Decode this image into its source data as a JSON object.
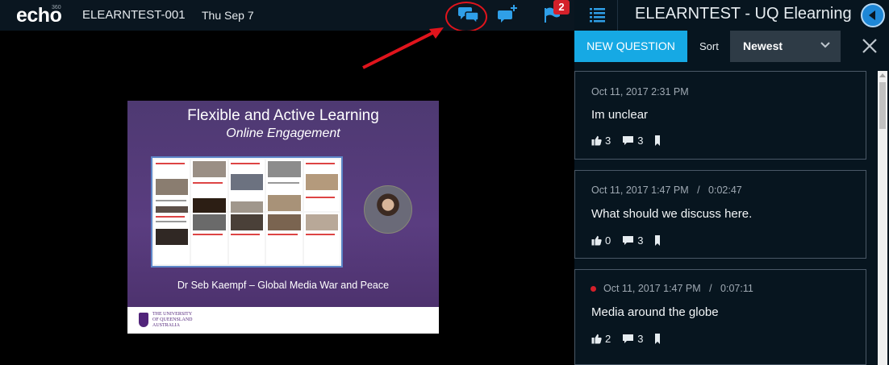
{
  "header": {
    "logo": "echo",
    "logo_sup": "360",
    "course": "ELEARNTEST-001",
    "date": "Thu Sep 7",
    "flag_badge": "2",
    "icons": [
      "discussions-icon",
      "add-discussion-icon",
      "flag-icon"
    ]
  },
  "slide": {
    "title": "Flexible and Active Learning",
    "subtitle": "Online Engagement",
    "footer": "Dr Seb Kaempf – Global Media War and Peace",
    "uq_line1": "THE UNIVERSITY",
    "uq_line2": "OF QUEENSLAND",
    "uq_line3": "AUSTRALIA"
  },
  "panel": {
    "title": "ELEARNTEST - UQ Elearning",
    "new_question": "NEW QUESTION",
    "sort_label": "Sort",
    "sort_value": "Newest"
  },
  "questions": [
    {
      "date": "Oct 11, 2017 2:31 PM",
      "sep": "",
      "timecode": "",
      "text": "Im unclear",
      "likes": "3",
      "comments": "3",
      "unread": false
    },
    {
      "date": "Oct 11, 2017 1:47 PM",
      "sep": "/",
      "timecode": "0:02:47",
      "text": "What should we discuss here.",
      "likes": "0",
      "comments": "3",
      "unread": false
    },
    {
      "date": "Oct 11, 2017 1:47 PM",
      "sep": "/",
      "timecode": "0:07:11",
      "text": "Media around the globe",
      "likes": "2",
      "comments": "3",
      "unread": true
    }
  ],
  "colors": {
    "accent": "#16a9e4",
    "annotation": "#e0141c",
    "badge": "#d4202a",
    "panel_bg": "#07151f"
  }
}
